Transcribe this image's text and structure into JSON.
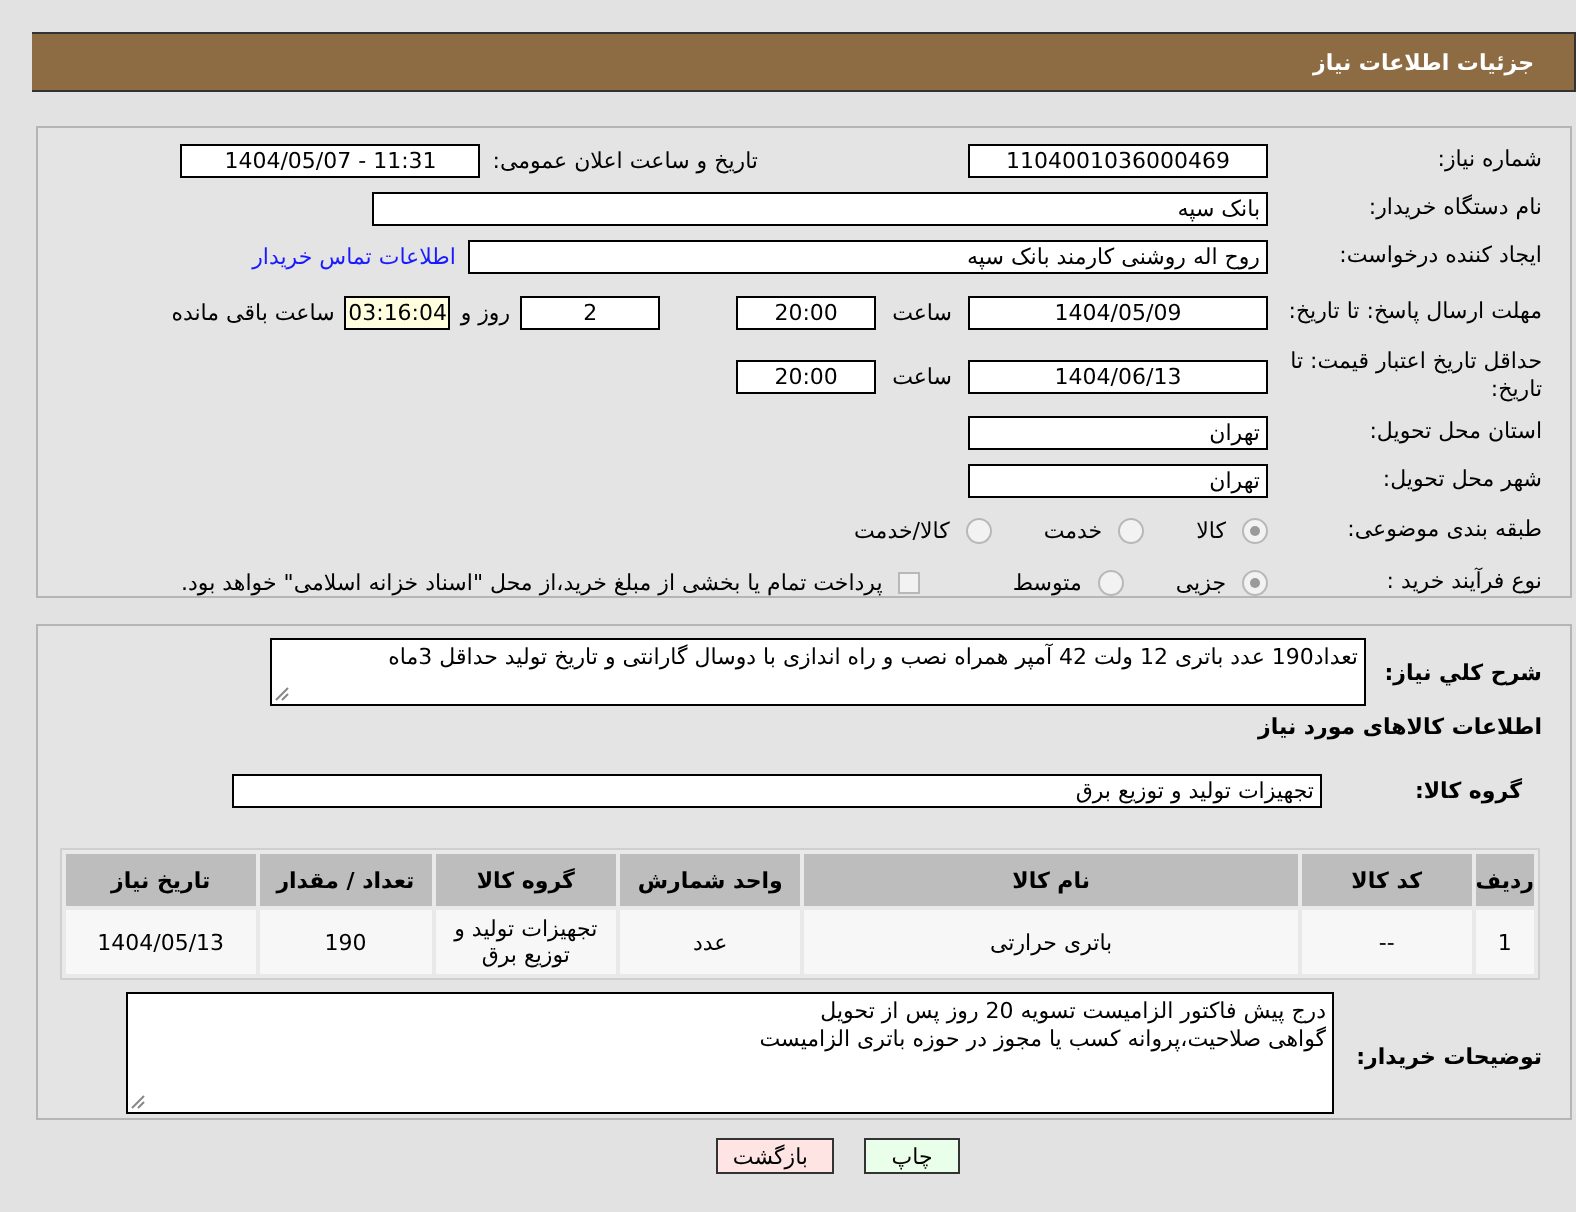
{
  "header": {
    "title": "جزئیات اطلاعات نیاز"
  },
  "need_number": {
    "label": "شماره نیاز:",
    "value": "1104001036000469"
  },
  "announce": {
    "label": "تاریخ و ساعت اعلان عمومی:",
    "value": "1404/05/07 - 11:31"
  },
  "buyer_org": {
    "label": "نام دستگاه خریدار:",
    "value": "بانک سپه"
  },
  "requester": {
    "label": "ایجاد کننده درخواست:",
    "value": "روح اله روشنی کارمند بانک سپه",
    "link": "اطلاعات تماس خریدار"
  },
  "deadline": {
    "label": "مهلت ارسال پاسخ: تا تاریخ:",
    "date": "1404/05/09",
    "time_label": "ساعت",
    "time": "20:00",
    "days": "2",
    "days_label": "روز و",
    "remaining": "03:16:04",
    "remaining_label": "ساعت باقی مانده"
  },
  "price_validity": {
    "label": "حداقل تاریخ اعتبار قیمت: تا تاریخ:",
    "date": "1404/06/13",
    "time_label": "ساعت",
    "time": "20:00"
  },
  "province": {
    "label": "استان محل تحویل:",
    "value": "تهران"
  },
  "city": {
    "label": "شهر محل تحویل:",
    "value": "تهران"
  },
  "category": {
    "label": "طبقه بندی موضوعی:",
    "options": [
      {
        "label": "کالا",
        "selected": true
      },
      {
        "label": "خدمت",
        "selected": false
      },
      {
        "label": "کالا/خدمت",
        "selected": false
      }
    ]
  },
  "purchase_type": {
    "label": "نوع فرآیند خرید :",
    "options": [
      {
        "label": "جزیی",
        "selected": true
      },
      {
        "label": "متوسط",
        "selected": false
      }
    ],
    "payment": {
      "checked": false,
      "text": "پرداخت تمام یا بخشی از مبلغ خرید،از محل \"اسناد خزانه اسلامی\" خواهد بود."
    }
  },
  "description": {
    "label": "شرح کلي نياز:",
    "value": "تعداد190 عدد باتری 12 ولت 42 آمپر همراه نصب و راه اندازی با دوسال گارانتی و تاریخ تولید حداقل 3ماه"
  },
  "goods_heading": "اطلاعات کالاهای مورد نیاز",
  "goods_group": {
    "label": "گروه کالا:",
    "value": "تجهیزات تولید و توزیع برق"
  },
  "table": {
    "columns": [
      "ردیف",
      "کد کالا",
      "نام کالا",
      "واحد شمارش",
      "گروه کالا",
      "تعداد / مقدار",
      "تاریخ نیاز"
    ],
    "rows": [
      [
        "1",
        "--",
        "باتری حرارتی",
        "عدد",
        "تجهیزات تولید و توزیع برق",
        "190",
        "1404/05/13"
      ]
    ]
  },
  "buyer_notes": {
    "label": "توضیحات خریدار:",
    "lines": [
      "درج پیش فاکتور الزامیست تسویه 20 روز پس از تحویل",
      "گواهی صلاحیت،پروانه کسب یا مجوز در حوزه باتری الزامیست"
    ]
  },
  "buttons": [
    {
      "label": "چاپ",
      "kind": "print"
    },
    {
      "label": "بازگشت",
      "kind": "back"
    }
  ]
}
